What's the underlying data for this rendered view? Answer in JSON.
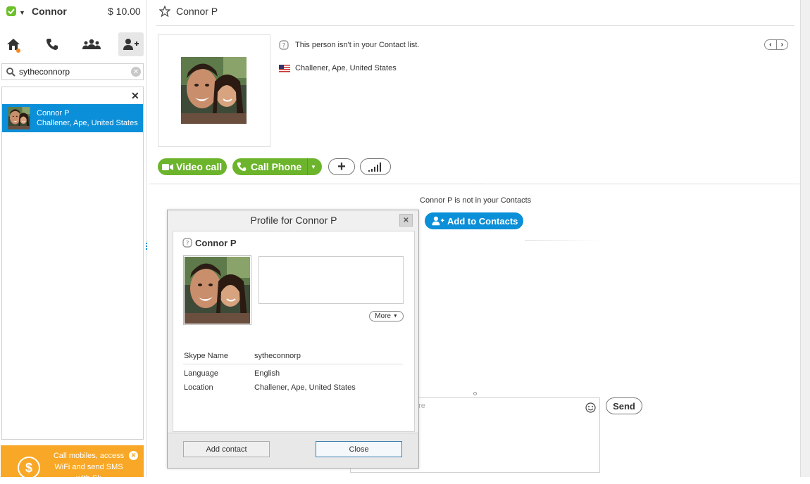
{
  "user": {
    "name": "Connor",
    "credit": "$ 10.00"
  },
  "nav": [
    "home-icon",
    "call-icon",
    "contacts-icon",
    "add-contact-icon"
  ],
  "search": {
    "value": "sytheconnorp",
    "placeholder": ""
  },
  "results": [
    {
      "name": "Connor P",
      "location": "Challener, Ape, United States"
    }
  ],
  "promo": {
    "text": "Call mobiles, access WiFi and send SMS with Sk"
  },
  "contact": {
    "name": "Connor P",
    "not_in_list": "This person isn't in your Contact list.",
    "location": "Challener, Ape, United States",
    "video_call_label": "Video call",
    "call_phone_label": "Call Phone",
    "not_in_contacts": "Connor P is not in your Contacts",
    "add_to_contacts_label": "Add to Contacts"
  },
  "compose": {
    "placeholder": "ere",
    "send_label": "Send"
  },
  "dialog": {
    "title": "Profile for Connor P",
    "name": "Connor P",
    "more_label": "More",
    "rows": [
      {
        "label": "Skype Name",
        "value": "sytheconnorp"
      },
      {
        "label": "Language",
        "value": "English"
      },
      {
        "label": "Location",
        "value": "Challener, Ape, United States"
      }
    ],
    "add_contact_label": "Add contact",
    "close_label": "Close"
  },
  "colors": {
    "accent": "#0b8fd8",
    "green": "#6cb42c",
    "promo": "#f8a826",
    "presence": "#6cc02a"
  }
}
